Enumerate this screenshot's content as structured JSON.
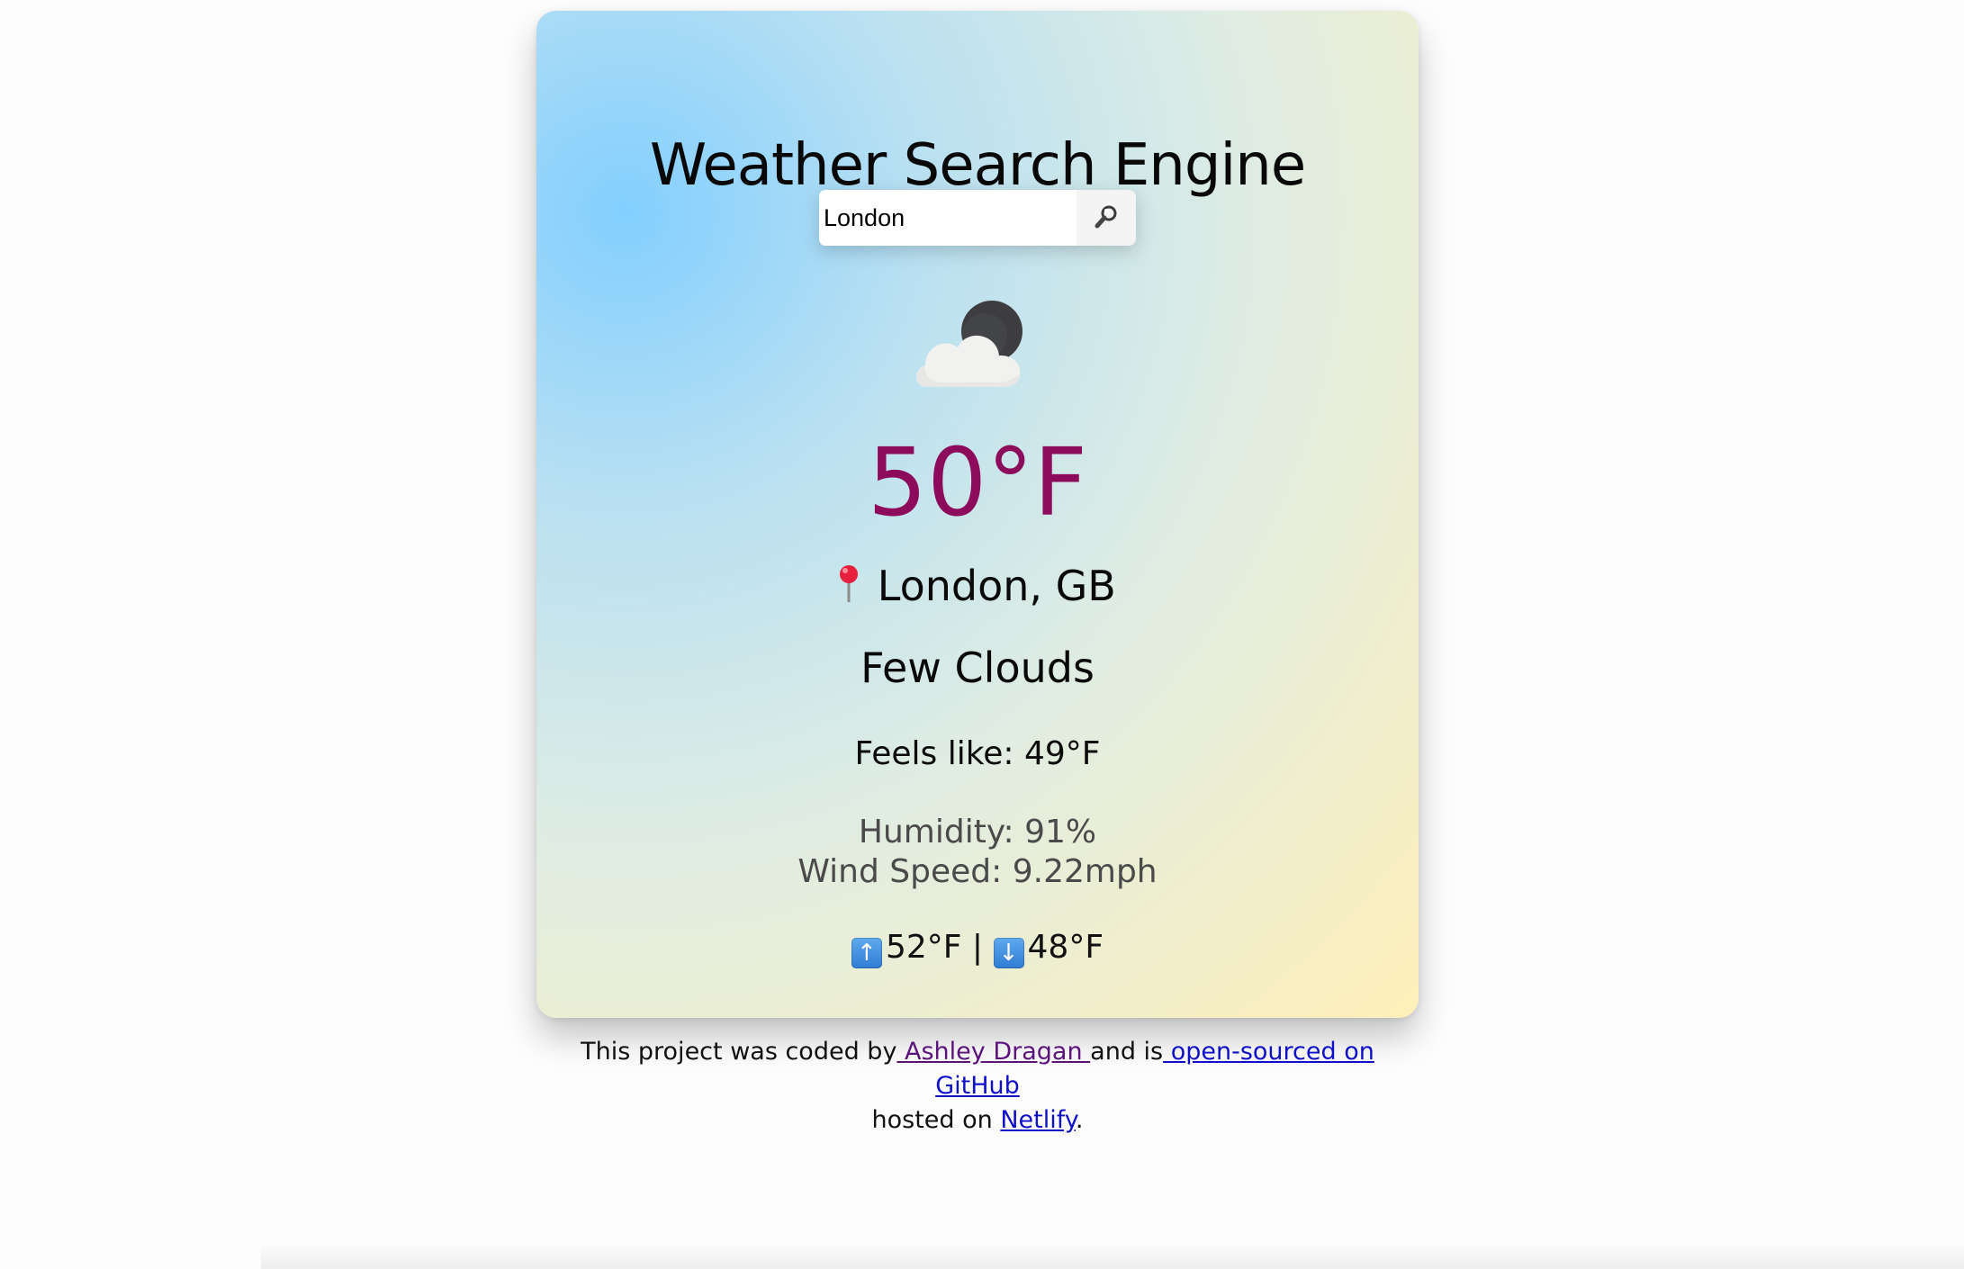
{
  "app": {
    "title": "Weather Search Engine"
  },
  "search": {
    "value": "London",
    "button_icon": "search-icon"
  },
  "weather": {
    "icon": "cloud-moon-icon",
    "temperature": "50°F",
    "location_icon": "pin-icon",
    "location": "London, GB",
    "description": "Few Clouds",
    "feels_like": "Feels like: 49°F",
    "humidity": "Humidity: 91%",
    "wind_speed": "Wind Speed: 9.22mph",
    "high": "52°F",
    "separator": "|",
    "low": "48°F",
    "high_icon": "up-arrow-icon",
    "low_icon": "down-arrow-icon"
  },
  "footer": {
    "text_before": "This project was coded by",
    "author": " Ashley Dragan ",
    "text_middle": "and is",
    "github": " open-sourced on GitHub",
    "text_hosted": "hosted on ",
    "netlify": "Netlify",
    "period": "."
  },
  "colors": {
    "temperature": "#8c0b5a",
    "link": "#1010c9",
    "visited_link": "#5b157a"
  }
}
